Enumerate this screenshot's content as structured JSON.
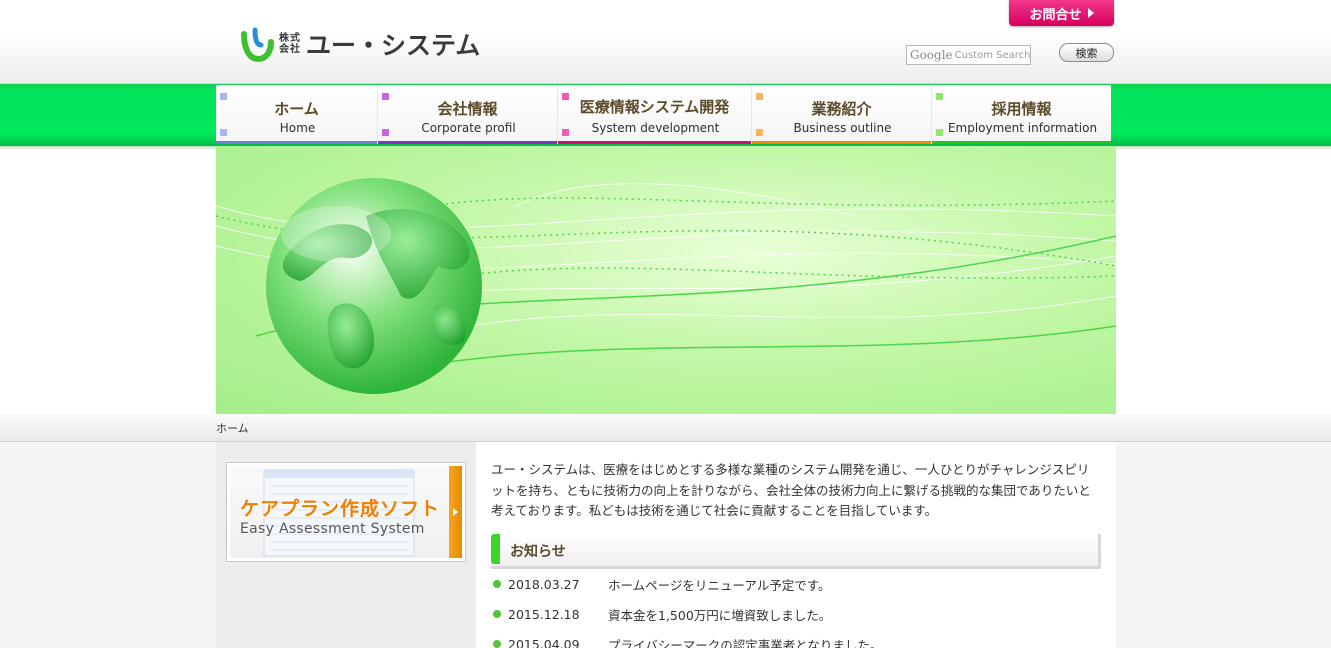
{
  "header": {
    "logo_corp_1": "株式",
    "logo_corp_2": "会社",
    "logo_name": "ユー・システム",
    "contact_label": "お問合せ",
    "search_brand": "Google",
    "search_placeholder": "Custom Search",
    "search_button": "検索"
  },
  "nav": [
    {
      "jp": "ホーム",
      "en": "Home",
      "color": "#6f7fd8",
      "sq": "#a8b8ee"
    },
    {
      "jp": "会社情報",
      "en": "Corporate profil",
      "color": "#8a2fc4",
      "sq": "#c966e4"
    },
    {
      "jp": "医療情報システム開発",
      "en": "System development",
      "color": "#d40a7a",
      "sq": "#ef5bb2"
    },
    {
      "jp": "業務紹介",
      "en": "Business outline",
      "color": "#f08a00",
      "sq": "#f6b45c"
    },
    {
      "jp": "採用情報",
      "en": "Employment information",
      "color": "#27c21f",
      "sq": "#8fe86a"
    }
  ],
  "breadcrumb": "ホーム",
  "banner": {
    "title": "ケアプラン作成ソフト",
    "subtitle": "Easy Assessment System"
  },
  "intro": "ユー・システムは、医療をはじめとする多様な業種のシステム開発を通じ、一人ひとりがチャレンジスピリットを持ち、ともに技術力の向上を計りながら、会社全体の技術力向上に繋げる挑戦的な集団でありたいと考えております。私どもは技術を通じて社会に貢献することを目指しています。",
  "news": {
    "title": "お知らせ",
    "items": [
      {
        "date": "2018.03.27",
        "text": "ホームページをリニューアル予定です。"
      },
      {
        "date": "2015.12.18",
        "text": "資本金を1,500万円に増資致しました。"
      },
      {
        "date": "2015.04.09",
        "text": "プライバシーマークの認定事業者となりました。"
      }
    ]
  },
  "colors": {
    "brand_green": "#00e35a",
    "contact_pink": "#e6106e",
    "accent_orange": "#f07f00"
  }
}
